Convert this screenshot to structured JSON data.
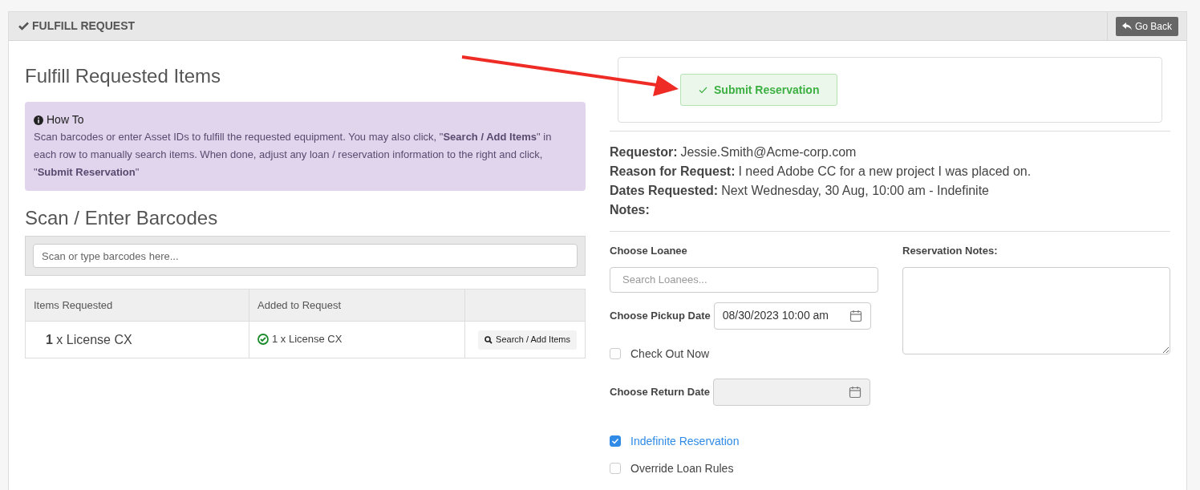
{
  "panel": {
    "title": "FULFILL REQUEST",
    "back_button": "Go Back"
  },
  "left": {
    "heading": "Fulfill Requested Items",
    "howto": {
      "title": "How To",
      "text": "Scan barcodes or enter Asset IDs to fulfill the requested equipment. You may also click, \"**Search / Add Items**\" in each row to manually search items. When done, adjust any loan / reservation information to the right and click, \"**Submit Reservation**\""
    },
    "scan_heading": "Scan / Enter Barcodes",
    "scan_field": {
      "placeholder": "Scan or type barcodes here..."
    },
    "table": {
      "columns": [
        "Items Requested",
        "Added to Request"
      ],
      "rows": [
        {
          "qty": "1",
          "item": "x License CX",
          "added": "1 x License CX",
          "action": "Search / Add Items"
        }
      ]
    }
  },
  "right": {
    "submit_button": "Submit Reservation",
    "details": [
      {
        "label": "Requestor:",
        "value": "Jessie.Smith@Acme-corp.com"
      },
      {
        "label": "Reason for Request:",
        "value": "I need Adobe CC for a new project I was placed on."
      },
      {
        "label": "Dates Requested:",
        "value": "Next Wednesday, 30 Aug, 10:00 am - Indefinite"
      },
      {
        "label": "Notes:"
      }
    ],
    "loanee": {
      "label": "Choose Loanee",
      "placeholder": "Search Loanees..."
    },
    "pickup": {
      "label": "Choose Pickup Date",
      "value": "08/30/2023 10:00 am",
      "disabled": false
    },
    "check_out_now": {
      "label": "Check Out Now",
      "checked": false
    },
    "return": {
      "label": "Choose Return Date",
      "disabled": true
    },
    "options": [
      {
        "label": "Indefinite Reservation",
        "checked": true
      },
      {
        "label": "Override Loan Rules",
        "checked": false
      }
    ],
    "notes": {
      "label": "Reservation Notes:"
    }
  }
}
